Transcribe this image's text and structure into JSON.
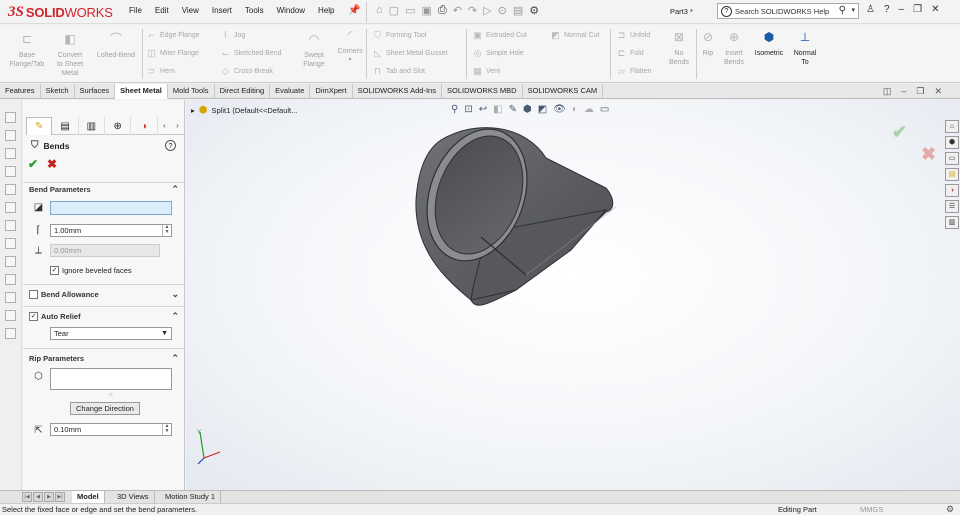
{
  "app": {
    "logo_ds": "3S",
    "logo_solid": "SOLID",
    "logo_works": "WORKS",
    "menus": [
      "File",
      "Edit",
      "View",
      "Insert",
      "Tools",
      "Window",
      "Help"
    ],
    "document_title": "Part3 *",
    "search_placeholder": "Search SOLIDWORKS Help"
  },
  "ribbon": {
    "base_flange": "Base\nFlange/Tab",
    "convert": "Convert\nto Sheet\nMetal",
    "lofted_bend": "Lofted-Bend",
    "edge_flange": "Edge Flange",
    "miter_flange": "Miter Flange",
    "hem": "Hem",
    "jog": "Jog",
    "sketched_bend": "Sketched Bend",
    "cross_break": "Cross-Break",
    "swept_flange": "Swept\nFlange",
    "corners": "Corners",
    "forming_tool": "Forming Tool",
    "sheet_metal_gusset": "Sheet Metal Gusset",
    "tab_and_slot": "Tab and Slot",
    "extruded_cut": "Extruded Cut",
    "simple_hole": "Simple Hole",
    "vent": "Vent",
    "normal_cut": "Normal Cut",
    "unfold": "Unfold",
    "fold": "Fold",
    "flatten": "Flatten",
    "no_bends": "No\nBends",
    "rip": "Rip",
    "insert_bends": "Insert\nBends",
    "isometric": "Isometric",
    "normal_to": "Normal\nTo"
  },
  "tabs": [
    "Features",
    "Sketch",
    "Surfaces",
    "Sheet Metal",
    "Mold Tools",
    "Direct Editing",
    "Evaluate",
    "DimXpert",
    "SOLIDWORKS Add-Ins",
    "SOLIDWORKS MBD",
    "SOLIDWORKS CAM"
  ],
  "active_tab": "Sheet Metal",
  "property_manager": {
    "title": "Bends",
    "bend_parameters": {
      "header": "Bend Parameters",
      "fixed_face_value": "",
      "radius": "1.00mm",
      "thickness": "0.00mm",
      "ignore_beveled_label": "Ignore beveled faces",
      "ignore_beveled_checked": true
    },
    "bend_allowance": {
      "header": "Bend Allowance",
      "checked": false
    },
    "auto_relief": {
      "header": "Auto Relief",
      "checked": true,
      "type": "Tear"
    },
    "rip_parameters": {
      "header": "Rip Parameters",
      "edges_value": "",
      "change_direction": "Change Direction",
      "gap": "0.10mm"
    }
  },
  "viewport": {
    "breadcrumb": "Split1  (Default<<Default..."
  },
  "bottom_tabs": [
    "Model",
    "3D Views",
    "Motion Study 1"
  ],
  "active_bottom_tab": "Model",
  "status": {
    "message": "Select the fixed face or edge and set the bend parameters.",
    "mode": "Editing Part",
    "units": "MMGS"
  },
  "colors": {
    "brand": "#d2232a",
    "ok": "#2e9a2e",
    "cancel": "#c82020",
    "selection_field": "#dcecf9",
    "model_gray": "#5e6066"
  }
}
